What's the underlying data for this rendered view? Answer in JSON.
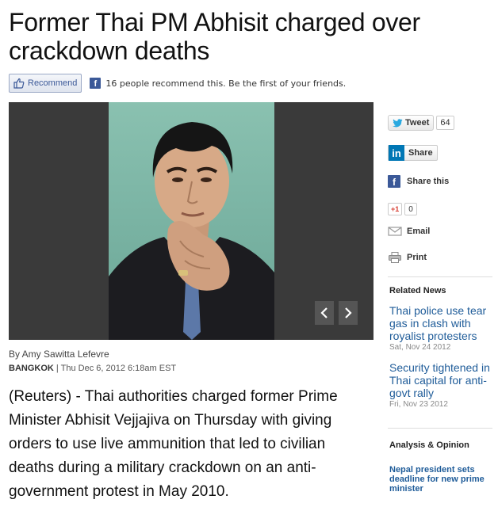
{
  "article": {
    "headline": "Former Thai PM Abhisit charged over crackdown deaths",
    "byline": "By Amy Sawitta Lefevre",
    "location": "BANGKOK",
    "date": "| Thu Dec 6, 2012 6:18am EST",
    "lede": "(Reuters) - Thai authorities charged former Prime Minister Abhisit Vejjajiva on Thursday with giving orders to use live ammunition that led to civilian deaths during a military crackdown on an anti-government protest in May 2010."
  },
  "facebook": {
    "recommend_label": "Recommend",
    "logo_letter": "f",
    "recommend_text": "16 people recommend this. Be the first of your friends."
  },
  "photo": {
    "prev_icon": "chevron-left-icon",
    "next_icon": "chevron-right-icon"
  },
  "share": {
    "tweet_label": "Tweet",
    "tweet_count": "64",
    "linkedin_logo": "in",
    "linkedin_label": "Share",
    "facebook_label": "Share this",
    "gplus_label": "+1",
    "gplus_count": "0",
    "email_label": "Email",
    "print_label": "Print"
  },
  "related": {
    "heading": "Related News",
    "items": [
      {
        "title": "Thai police use tear gas in clash with royalist protesters",
        "date": "Sat, Nov 24 2012"
      },
      {
        "title": "Security tightened in Thai capital for anti-govt rally",
        "date": "Fri, Nov 23 2012"
      }
    ]
  },
  "analysis": {
    "heading": "Analysis & Opinion",
    "items": [
      {
        "title": "Nepal president sets deadline for new prime minister"
      }
    ]
  },
  "colors": {
    "link": "#1f5c99",
    "facebook": "#3b5998",
    "linkedin": "#0077b5",
    "twitter": "#2aa9e0"
  }
}
